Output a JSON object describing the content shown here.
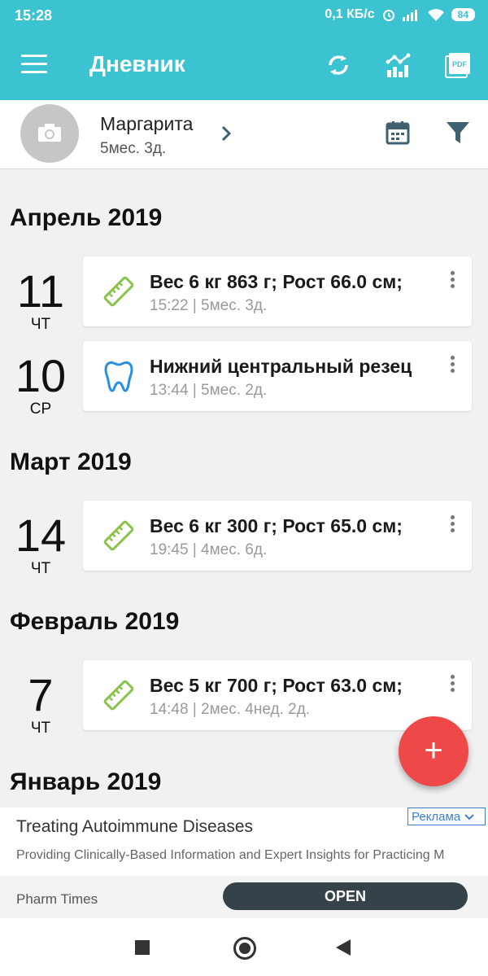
{
  "status_bar": {
    "time": "15:28",
    "speed": "0,1 КБ/с",
    "battery": "84"
  },
  "app_bar": {
    "title": "Дневник"
  },
  "profile": {
    "name": "Маргарита",
    "age": "5мес. 3д."
  },
  "months": [
    {
      "label": "Апрель 2019"
    },
    {
      "label": "Март 2019"
    },
    {
      "label": "Февраль 2019"
    },
    {
      "label": "Январь 2019"
    }
  ],
  "entries": [
    {
      "day": "11",
      "dow": "ЧТ",
      "icon": "ruler-icon",
      "title": "Вес 6 кг 863 г; Рост 66.0 см;",
      "sub": "15:22  |  5мес. 3д."
    },
    {
      "day": "10",
      "dow": "СР",
      "icon": "tooth-icon",
      "title": "Нижний центральный резец",
      "sub": "13:44  |  5мес. 2д."
    },
    {
      "day": "14",
      "dow": "ЧТ",
      "icon": "ruler-icon",
      "title": "Вес 6 кг 300 г; Рост 65.0 см;",
      "sub": "19:45  |  4мес. 6д."
    },
    {
      "day": "7",
      "dow": "ЧТ",
      "icon": "ruler-icon",
      "title": "Вес 5 кг 700 г; Рост 63.0 см;",
      "sub": "14:48  |  2мес. 4нед. 2д."
    }
  ],
  "fab": {
    "label": "+"
  },
  "ad": {
    "title": "Treating Autoimmune Diseases",
    "description": "Providing Clinically-Based Information and Expert Insights for Practicing M",
    "badge": "Реклама",
    "source": "Pharm Times",
    "cta": "OPEN"
  },
  "colors": {
    "accent": "#3bc3d2",
    "fab": "#ef4848",
    "ruler": "#8bc34a",
    "tooth": "#2a8fe0"
  }
}
